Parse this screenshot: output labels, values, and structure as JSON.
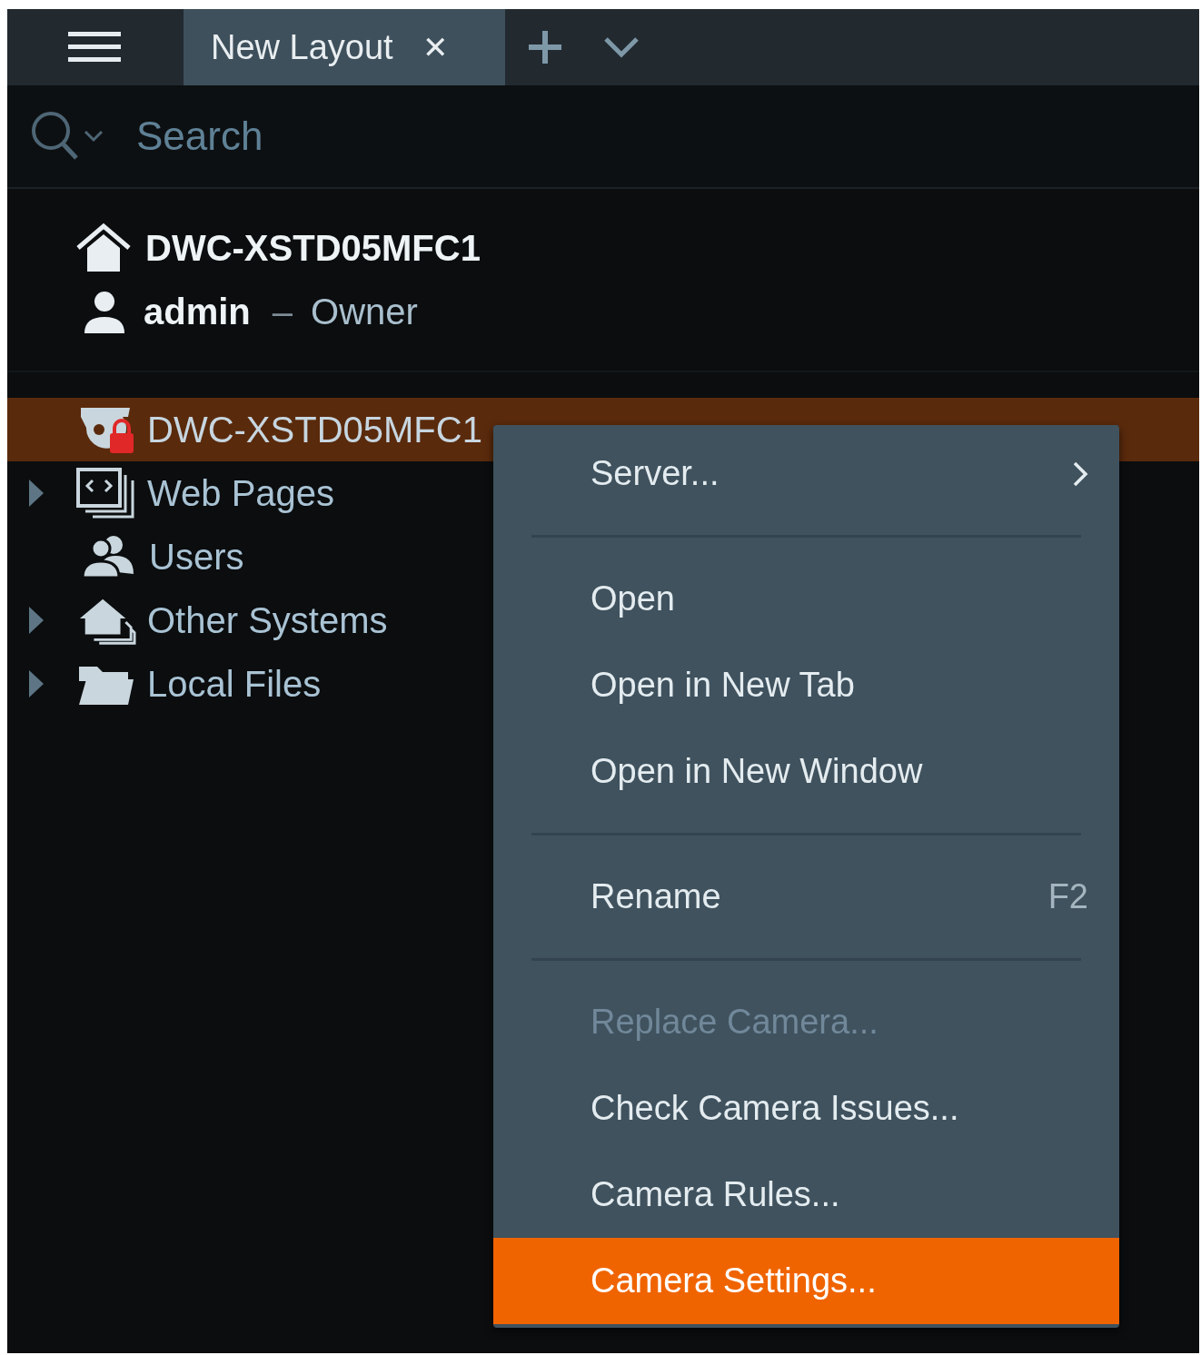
{
  "top_bar": {
    "tabs": [
      {
        "label": "New Layout",
        "selected": true,
        "closable": true
      }
    ],
    "close_glyph": "✕"
  },
  "search": {
    "placeholder": "Search"
  },
  "system": {
    "name": "DWC-XSTD05MFC1",
    "user": "admin",
    "separator": "–",
    "role": "Owner"
  },
  "tree": [
    {
      "kind": "camera",
      "name": "DWC-XSTD05MFC1",
      "selected": true,
      "expandable": false,
      "locked": true
    },
    {
      "kind": "webpages",
      "name": "Web Pages",
      "selected": false,
      "expandable": true
    },
    {
      "kind": "users",
      "name": "Users",
      "selected": false,
      "expandable": false
    },
    {
      "kind": "systems",
      "name": "Other Systems",
      "selected": false,
      "expandable": true
    },
    {
      "kind": "folder",
      "name": "Local Files",
      "selected": false,
      "expandable": true
    }
  ],
  "context_menu": [
    {
      "kind": "item",
      "label": "Server...",
      "submenu": true,
      "disabled": false,
      "selected": false
    },
    {
      "kind": "separator"
    },
    {
      "kind": "item",
      "label": "Open",
      "submenu": false,
      "disabled": false,
      "selected": false
    },
    {
      "kind": "item",
      "label": "Open in New Tab",
      "submenu": false,
      "disabled": false,
      "selected": false
    },
    {
      "kind": "item",
      "label": "Open in New Window",
      "submenu": false,
      "disabled": false,
      "selected": false
    },
    {
      "kind": "separator"
    },
    {
      "kind": "item",
      "label": "Rename",
      "shortcut": "F2",
      "submenu": false,
      "disabled": false,
      "selected": false
    },
    {
      "kind": "separator"
    },
    {
      "kind": "item",
      "label": "Replace Camera...",
      "submenu": false,
      "disabled": true,
      "selected": false
    },
    {
      "kind": "item",
      "label": "Check Camera Issues...",
      "submenu": false,
      "disabled": false,
      "selected": false
    },
    {
      "kind": "item",
      "label": "Camera Rules...",
      "submenu": false,
      "disabled": false,
      "selected": false
    },
    {
      "kind": "item",
      "label": "Camera Settings...",
      "submenu": false,
      "disabled": false,
      "selected": true
    }
  ]
}
